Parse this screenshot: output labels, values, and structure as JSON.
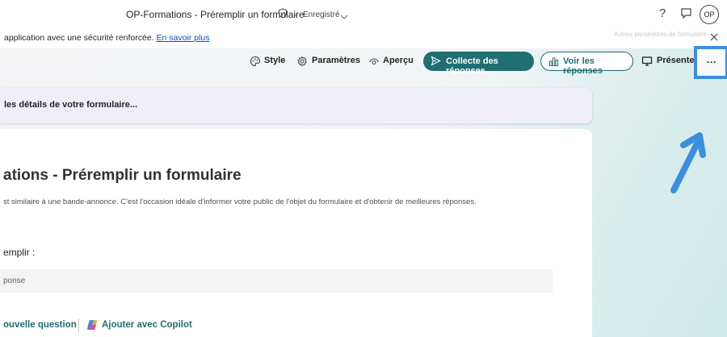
{
  "titlebar": {
    "title": "OP-Formations - Préremplir un formulaire",
    "separator": "-",
    "saved_label": "Enregistré",
    "help_label": "?",
    "avatar_initials": "OP"
  },
  "notice": {
    "message": "application avec une sécurité renforcée.",
    "link_label": "En savoir plus",
    "ghost_text": "Autres paramètres de formulaire"
  },
  "toolbar": {
    "style_label": "Style",
    "settings_label": "Paramètres",
    "preview_label": "Aperçu",
    "collect_label": "Collecte des réponses",
    "view_responses_label": "Voir les réponses",
    "present_label": "Présenter",
    "more_label": "···",
    "accent_color": "#1f6e72"
  },
  "banner": {
    "text": "les détails de votre formulaire..."
  },
  "form": {
    "title": "ations - Préremplir un formulaire",
    "description": "st similaire à une bande-annonce. C'est l'occasion idéale d'informer votre public de l'objet du formulaire et d'obtenir de meilleures réponses.",
    "question_label": "emplir :",
    "answer_placeholder": "ponse",
    "new_question_label": "ouvelle question",
    "copilot_label": "Ajouter avec Copilot"
  },
  "highlight_color": "#3a8fe0"
}
